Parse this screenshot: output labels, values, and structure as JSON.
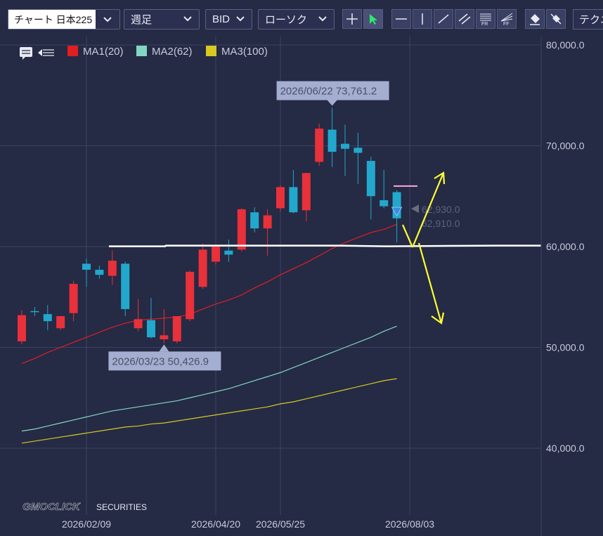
{
  "toolbar": {
    "symbol": "チャート 日本225",
    "period": "週足",
    "price_type": "BID",
    "chart_style": "ローソク",
    "tech_label": "テクニ",
    "tools": [
      {
        "name": "crosshair-tool-button",
        "icon": "crosshair-icon",
        "active": false
      },
      {
        "name": "pointer-tool-button",
        "icon": "cursor-arrow-icon",
        "active": true
      },
      {
        "name": "horizontal-line-tool-button",
        "icon": "horizontal-line-icon",
        "active": false
      },
      {
        "name": "vertical-line-tool-button",
        "icon": "vertical-line-icon",
        "active": false
      },
      {
        "name": "trend-line-tool-button",
        "icon": "trend-line-icon",
        "active": false
      },
      {
        "name": "channel-tool-button",
        "icon": "parallel-lines-icon",
        "active": false
      },
      {
        "name": "fibonacci-retracement-tool-button",
        "icon": "fibonacci-retracement-icon",
        "label": "FR",
        "active": false
      },
      {
        "name": "fibonacci-fan-tool-button",
        "icon": "fibonacci-fan-icon",
        "label": "FF",
        "active": false
      },
      {
        "name": "eraser-tool-button",
        "icon": "eraser-icon",
        "active": false
      },
      {
        "name": "erase-all-tool-button",
        "icon": "erase-all-icon",
        "active": false
      }
    ]
  },
  "colors": {
    "background": "#252a45",
    "grid": "#3c4262",
    "up_candle": "#e8313a",
    "down_candle": "#22a8cc",
    "ma1": "#e02020",
    "ma2": "#80d8c0",
    "ma3": "#d8c820",
    "user_lines": "#ffffff",
    "arrows": "#ffff33",
    "callout": "#a4aed0",
    "pink_marker": "#ffa8d8"
  },
  "watermark": {
    "brand": "GMOCLICK",
    "suffix": "SECURITIES"
  },
  "chart_data": {
    "type": "candlestick",
    "instrument": "日本225",
    "timeframe": "週足",
    "legend": [
      {
        "name": "MA1(20)",
        "color": "#e02020"
      },
      {
        "name": "MA2(62)",
        "color": "#80d8c0"
      },
      {
        "name": "MA3(100)",
        "color": "#d8c820"
      }
    ],
    "y_ticks": [
      80000,
      70000,
      60000,
      50000,
      40000
    ],
    "y_tick_labels": [
      "80,000.0",
      "70,000.0",
      "60,000.0",
      "50,000.0",
      "40,000.0"
    ],
    "ylim": [
      35200,
      82000
    ],
    "x_ticks": [
      {
        "label": "2026/02/09",
        "week": 5
      },
      {
        "label": "2026/04/20",
        "week": 15
      },
      {
        "label": "2026/05/25",
        "week": 20
      },
      {
        "label": "2026/08/03",
        "week": 30
      }
    ],
    "candles": [
      {
        "week": 0,
        "o": 50600,
        "h": 53700,
        "l": 50300,
        "c": 53200
      },
      {
        "week": 1,
        "o": 53600,
        "h": 54000,
        "l": 53100,
        "c": 53500
      },
      {
        "week": 2,
        "o": 53300,
        "h": 54200,
        "l": 51700,
        "c": 52600
      },
      {
        "week": 3,
        "o": 51900,
        "h": 53100,
        "l": 51700,
        "c": 53100
      },
      {
        "week": 4,
        "o": 53400,
        "h": 56600,
        "l": 52600,
        "c": 56300
      },
      {
        "week": 5,
        "o": 58300,
        "h": 58800,
        "l": 56000,
        "c": 57700
      },
      {
        "week": 6,
        "o": 57700,
        "h": 58100,
        "l": 56800,
        "c": 57200
      },
      {
        "week": 7,
        "o": 57100,
        "h": 59600,
        "l": 56200,
        "c": 58600
      },
      {
        "week": 8,
        "o": 58300,
        "h": 58500,
        "l": 53100,
        "c": 53800
      },
      {
        "week": 9,
        "o": 51900,
        "h": 54800,
        "l": 51600,
        "c": 52800
      },
      {
        "week": 10,
        "o": 52700,
        "h": 54900,
        "l": 50900,
        "c": 51000
      },
      {
        "week": 11,
        "o": 50800,
        "h": 53800,
        "l": 50400,
        "c": 51200
      },
      {
        "week": 12,
        "o": 50600,
        "h": 52900,
        "l": 50400,
        "c": 53100
      },
      {
        "week": 13,
        "o": 52800,
        "h": 57600,
        "l": 52600,
        "c": 57500
      },
      {
        "week": 14,
        "o": 56000,
        "h": 60300,
        "l": 55800,
        "c": 59700
      },
      {
        "week": 15,
        "o": 58500,
        "h": 60100,
        "l": 58200,
        "c": 60000
      },
      {
        "week": 16,
        "o": 59600,
        "h": 60700,
        "l": 58500,
        "c": 59200
      },
      {
        "week": 17,
        "o": 59700,
        "h": 63800,
        "l": 59500,
        "c": 63700
      },
      {
        "week": 18,
        "o": 63400,
        "h": 63900,
        "l": 61400,
        "c": 61800
      },
      {
        "week": 19,
        "o": 61800,
        "h": 63700,
        "l": 59100,
        "c": 63100
      },
      {
        "week": 20,
        "o": 63800,
        "h": 66100,
        "l": 63500,
        "c": 65900
      },
      {
        "week": 21,
        "o": 65900,
        "h": 67600,
        "l": 63300,
        "c": 63400
      },
      {
        "week": 22,
        "o": 63600,
        "h": 67300,
        "l": 62500,
        "c": 67300
      },
      {
        "week": 23,
        "o": 68400,
        "h": 72200,
        "l": 68000,
        "c": 71700
      },
      {
        "week": 24,
        "o": 71600,
        "h": 73761.2,
        "l": 67900,
        "c": 69400
      },
      {
        "week": 25,
        "o": 70200,
        "h": 72100,
        "l": 67000,
        "c": 69700
      },
      {
        "week": 26,
        "o": 69800,
        "h": 71300,
        "l": 66200,
        "c": 69300
      },
      {
        "week": 27,
        "o": 68500,
        "h": 68900,
        "l": 62700,
        "c": 65000
      },
      {
        "week": 28,
        "o": 64600,
        "h": 67600,
        "l": 63800,
        "c": 64000
      },
      {
        "week": 29,
        "o": 65400,
        "h": 65600,
        "l": 60400,
        "c": 62800
      }
    ],
    "ma1": [
      48400,
      48900,
      49500,
      50000,
      50500,
      51000,
      51500,
      52000,
      52400,
      52700,
      52800,
      52900,
      53000,
      53300,
      53800,
      54300,
      54700,
      55200,
      55900,
      56500,
      57200,
      57800,
      58400,
      59100,
      59800,
      60400,
      60900,
      61400,
      61700,
      62200
    ],
    "ma2": [
      41700,
      41900,
      42200,
      42500,
      42800,
      43100,
      43400,
      43700,
      43900,
      44100,
      44300,
      44500,
      44700,
      45000,
      45300,
      45600,
      45900,
      46300,
      46700,
      47100,
      47500,
      48000,
      48500,
      49000,
      49500,
      50000,
      50500,
      51000,
      51600,
      52100
    ],
    "ma3": [
      40500,
      40700,
      40900,
      41100,
      41300,
      41500,
      41700,
      41900,
      42100,
      42200,
      42400,
      42500,
      42700,
      42900,
      43100,
      43300,
      43500,
      43700,
      43900,
      44100,
      44400,
      44600,
      44900,
      45200,
      45500,
      45800,
      46100,
      46400,
      46700,
      46900
    ],
    "annotations": [
      {
        "text": "2026/06/22 73,761.2",
        "week": 24,
        "price": 73761.2,
        "placement": "above"
      },
      {
        "text": "2026/03/23 50,426.9",
        "week": 11,
        "price": 50426.9,
        "placement": "below"
      }
    ],
    "current_price_labels": [
      "62,930.0",
      "62,910.0"
    ],
    "current_price_marker": 62920,
    "pink_marker_price": 66000,
    "horizontal_line_price": 60100
  }
}
